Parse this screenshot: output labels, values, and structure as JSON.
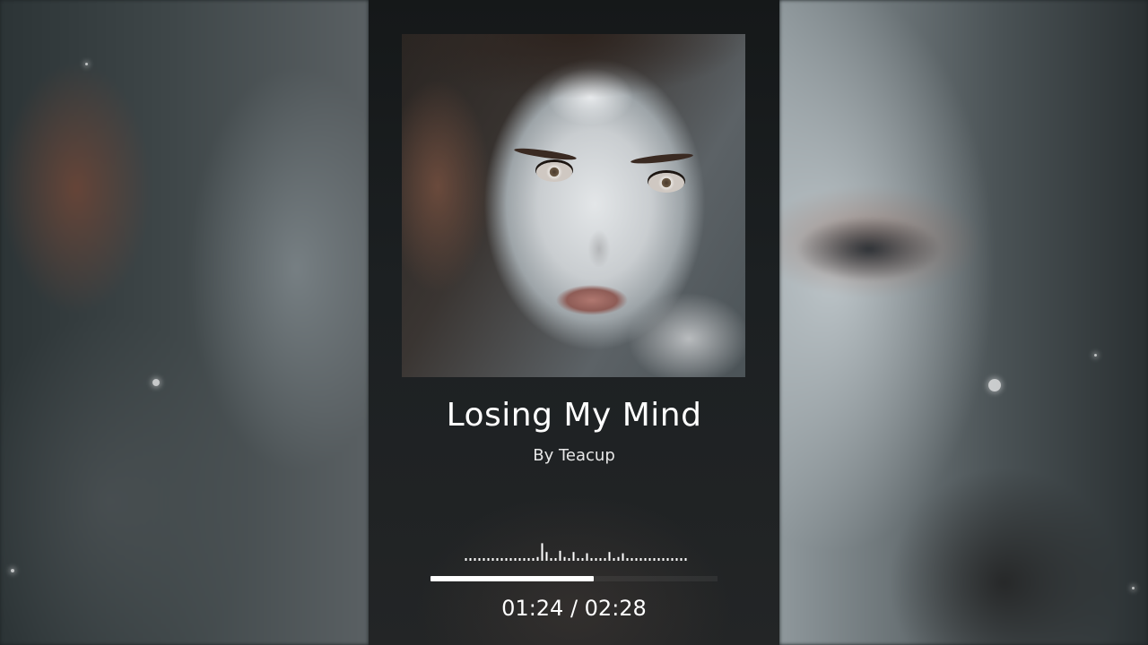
{
  "track": {
    "title": "Losing My  Mind",
    "artist": "By Teacup"
  },
  "playback": {
    "current_time": "01:24",
    "total_time": "02:28",
    "time_display": "01:24 / 02:28",
    "progress": 0.568
  },
  "colors": {
    "progress_fill": "#ffffff",
    "text": "#ffffff",
    "panel_bg": "#1c2022"
  },
  "visualizer": {
    "bar_levels": [
      0.1,
      0.1,
      0.1,
      0.1,
      0.1,
      0.1,
      0.1,
      0.1,
      0.1,
      0.1,
      0.1,
      0.1,
      0.1,
      0.1,
      0.1,
      0.1,
      0.15,
      0.7,
      0.35,
      0.1,
      0.1,
      0.4,
      0.15,
      0.1,
      0.35,
      0.1,
      0.1,
      0.3,
      0.1,
      0.1,
      0.1,
      0.1,
      0.35,
      0.1,
      0.15,
      0.3,
      0.1,
      0.1,
      0.1,
      0.1,
      0.1,
      0.1,
      0.1,
      0.1,
      0.1,
      0.1,
      0.1,
      0.1,
      0.1,
      0.1
    ]
  },
  "icons": {
    "cover_art": "album-cover-image"
  }
}
